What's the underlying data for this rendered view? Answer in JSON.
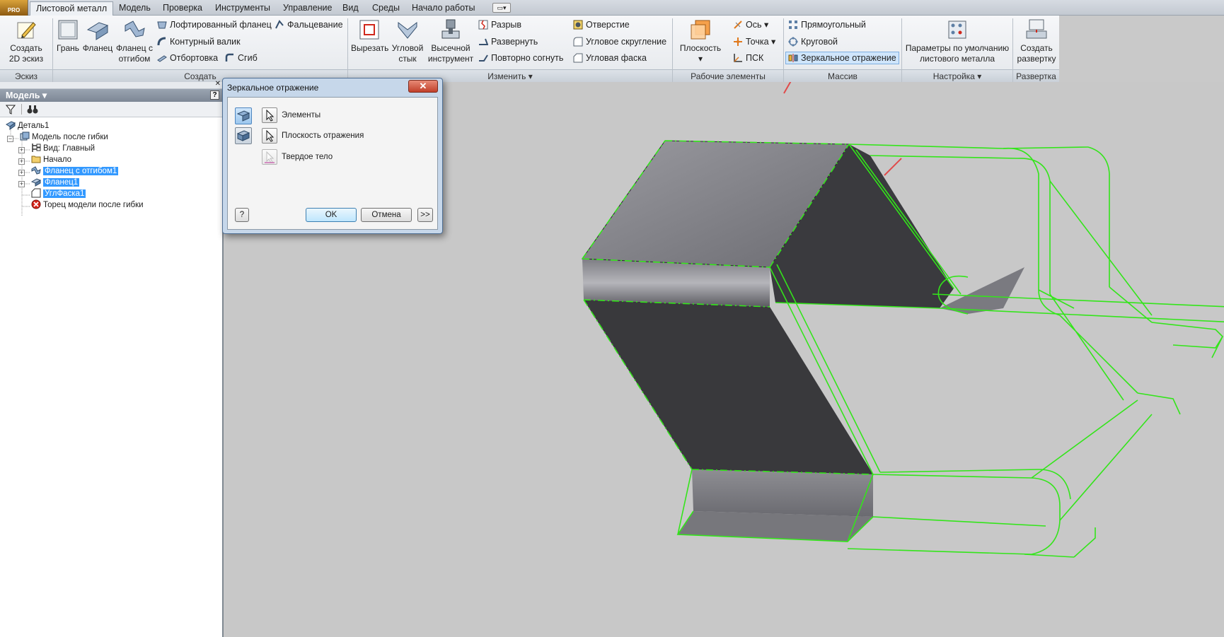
{
  "ribbon": {
    "app_badge": "PRO",
    "tabs": [
      "Листовой металл",
      "Модель",
      "Проверка",
      "Инструменты",
      "Управление",
      "Вид",
      "Среды",
      "Начало работы"
    ],
    "active_tab": "Листовой металл",
    "groups": {
      "sketch": {
        "title": "Эскиз",
        "create_2d_sketch_line1": "Создать",
        "create_2d_sketch_line2": "2D эскиз"
      },
      "create": {
        "title": "Создать",
        "face": "Грань",
        "flange": "Фланец",
        "contour_flange_line1": "Фланец с",
        "contour_flange_line2": "отгибом",
        "lofted_flange": "Лофтированный фланец",
        "contour_roll": "Контурный валик",
        "hem": "Отбортовка",
        "fold": "Фальцевание",
        "bend": "Сгиб"
      },
      "modify": {
        "title": "Изменить",
        "cut": "Вырезать",
        "corner_seam_line1": "Угловой",
        "corner_seam_line2": "стык",
        "punch_line1": "Высечной",
        "punch_line2": "инструмент",
        "rip": "Разрыв",
        "unfold": "Развернуть",
        "refold": "Повторно согнуть",
        "hole": "Отверстие",
        "corner_round": "Угловое скругление",
        "corner_chamfer": "Угловая фаска"
      },
      "work_features": {
        "title": "Рабочие элементы",
        "plane": "Плоскость",
        "axis": "Ось",
        "point": "Точка",
        "ucs": "ПСК"
      },
      "pattern": {
        "title": "Массив",
        "rectangular": "Прямоугольный",
        "circular": "Круговой",
        "mirror": "Зеркальное отражение"
      },
      "setup": {
        "title": "Настройка",
        "defaults_line1": "Параметры по умолчанию",
        "defaults_line2": "листового металла"
      },
      "flat_pattern": {
        "title": "Развертка",
        "create_line1": "Создать",
        "create_line2": "развертку"
      }
    }
  },
  "browser": {
    "title": "Модель",
    "help_label": "?",
    "tree": [
      {
        "label": "Деталь1"
      },
      {
        "label": "Модель после гибки"
      },
      {
        "label": "Вид: Главный"
      },
      {
        "label": "Начало"
      },
      {
        "label": "Фланец с отгибом1",
        "selected": true
      },
      {
        "label": "Фланец1",
        "selected": true
      },
      {
        "label": "УглФаска1",
        "selected": true
      },
      {
        "label": "Торец модели после гибки"
      }
    ]
  },
  "dialog": {
    "title": "Зеркальное отражение",
    "close_label": "✕",
    "features_label": "Элементы",
    "mirror_plane_label": "Плоскость отражения",
    "solid_label": "Твердое тело",
    "help_label": "?",
    "ok_label": "OK",
    "cancel_label": "Отмена",
    "more_label": ">>"
  },
  "colors": {
    "preview_wire": "#33e51a",
    "sheet_dark": "#3b3b3e",
    "sheet_light": "#8a8a8e",
    "annotation_arrow": "#e04a4a"
  }
}
